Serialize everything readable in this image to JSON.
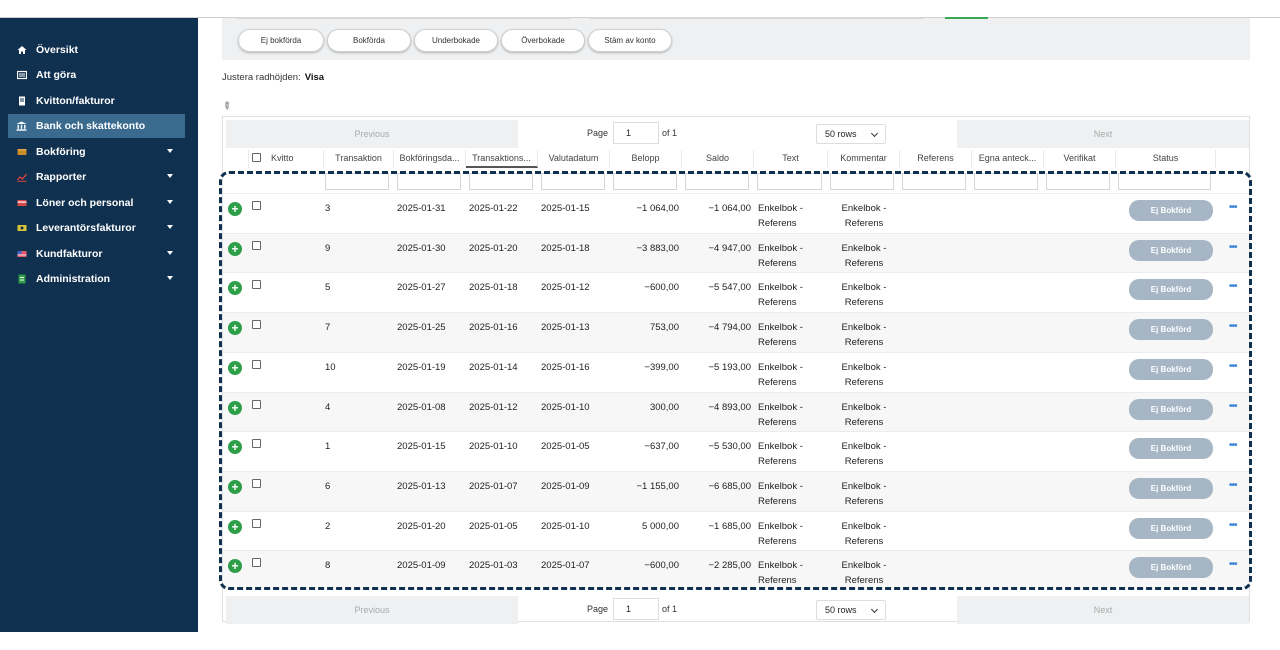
{
  "sidebar": {
    "items": [
      {
        "label": "Översikt",
        "icon": "home-icon",
        "active": false,
        "expandable": false
      },
      {
        "label": "Att göra",
        "icon": "list-icon",
        "active": false,
        "expandable": false
      },
      {
        "label": "Kvitton/fakturor",
        "icon": "receipt-icon",
        "active": false,
        "expandable": false
      },
      {
        "label": "Bank och skattekonto",
        "icon": "bank-icon",
        "active": true,
        "expandable": false
      },
      {
        "label": "Bokföring",
        "icon": "book-icon",
        "active": false,
        "expandable": true
      },
      {
        "label": "Rapporter",
        "icon": "chart-icon",
        "active": false,
        "expandable": true
      },
      {
        "label": "Löner och personal",
        "icon": "card-icon",
        "active": false,
        "expandable": true
      },
      {
        "label": "Leverantörsfakturor",
        "icon": "money-icon",
        "active": false,
        "expandable": true
      },
      {
        "label": "Kundfakturor",
        "icon": "flag-icon",
        "active": false,
        "expandable": true
      },
      {
        "label": "Administration",
        "icon": "document-icon",
        "active": false,
        "expandable": true
      }
    ]
  },
  "filters": {
    "chips": [
      "Ej bokförda",
      "Bokförda",
      "Underbokade",
      "Överbokade",
      "Stäm av konto"
    ]
  },
  "row_height": {
    "label": "Justera radhöjden:",
    "value": "Visa"
  },
  "pager": {
    "previous": "Previous",
    "page_label": "Page",
    "page_value": "1",
    "of_label": "of 1",
    "rows_option": "50 rows",
    "next": "Next"
  },
  "table": {
    "columns": [
      "",
      "Kvitto",
      "Transaktion",
      "Bokföringsda...",
      "Transaktions...",
      "Valutadatum",
      "Belopp",
      "Saldo",
      "Text",
      "Kommentar",
      "Referens",
      "Egna anteck...",
      "Verifikat",
      "Status"
    ],
    "sorted_column": "Transaktions...",
    "rows": [
      {
        "transaktion": "3",
        "bokforingsdatum": "2025-01-31",
        "transaktionsdatum": "2025-01-22",
        "valutadatum": "2025-01-15",
        "belopp": "−1 064,00",
        "saldo": "−1 064,00",
        "text_line1": "Enkelbok -",
        "text_line2": "Referens",
        "kommentar_line1": "Enkelbok -",
        "kommentar_line2": "Referens",
        "status": "Ej Bokförd"
      },
      {
        "transaktion": "9",
        "bokforingsdatum": "2025-01-30",
        "transaktionsdatum": "2025-01-20",
        "valutadatum": "2025-01-18",
        "belopp": "−3 883,00",
        "saldo": "−4 947,00",
        "text_line1": "Enkelbok -",
        "text_line2": "Referens",
        "kommentar_line1": "Enkelbok -",
        "kommentar_line2": "Referens",
        "status": "Ej Bokförd"
      },
      {
        "transaktion": "5",
        "bokforingsdatum": "2025-01-27",
        "transaktionsdatum": "2025-01-18",
        "valutadatum": "2025-01-12",
        "belopp": "−600,00",
        "saldo": "−5 547,00",
        "text_line1": "Enkelbok -",
        "text_line2": "Referens",
        "kommentar_line1": "Enkelbok -",
        "kommentar_line2": "Referens",
        "status": "Ej Bokförd"
      },
      {
        "transaktion": "7",
        "bokforingsdatum": "2025-01-25",
        "transaktionsdatum": "2025-01-16",
        "valutadatum": "2025-01-13",
        "belopp": "753,00",
        "saldo": "−4 794,00",
        "text_line1": "Enkelbok -",
        "text_line2": "Referens",
        "kommentar_line1": "Enkelbok -",
        "kommentar_line2": "Referens",
        "status": "Ej Bokförd"
      },
      {
        "transaktion": "10",
        "bokforingsdatum": "2025-01-19",
        "transaktionsdatum": "2025-01-14",
        "valutadatum": "2025-01-16",
        "belopp": "−399,00",
        "saldo": "−5 193,00",
        "text_line1": "Enkelbok -",
        "text_line2": "Referens",
        "kommentar_line1": "Enkelbok -",
        "kommentar_line2": "Referens",
        "status": "Ej Bokförd"
      },
      {
        "transaktion": "4",
        "bokforingsdatum": "2025-01-08",
        "transaktionsdatum": "2025-01-12",
        "valutadatum": "2025-01-10",
        "belopp": "300,00",
        "saldo": "−4 893,00",
        "text_line1": "Enkelbok -",
        "text_line2": "Referens",
        "kommentar_line1": "Enkelbok -",
        "kommentar_line2": "Referens",
        "status": "Ej Bokförd"
      },
      {
        "transaktion": "1",
        "bokforingsdatum": "2025-01-15",
        "transaktionsdatum": "2025-01-10",
        "valutadatum": "2025-01-05",
        "belopp": "−637,00",
        "saldo": "−5 530,00",
        "text_line1": "Enkelbok -",
        "text_line2": "Referens",
        "kommentar_line1": "Enkelbok -",
        "kommentar_line2": "Referens",
        "status": "Ej Bokförd"
      },
      {
        "transaktion": "6",
        "bokforingsdatum": "2025-01-13",
        "transaktionsdatum": "2025-01-07",
        "valutadatum": "2025-01-09",
        "belopp": "−1 155,00",
        "saldo": "−6 685,00",
        "text_line1": "Enkelbok -",
        "text_line2": "Referens",
        "kommentar_line1": "Enkelbok -",
        "kommentar_line2": "Referens",
        "status": "Ej Bokförd"
      },
      {
        "transaktion": "2",
        "bokforingsdatum": "2025-01-20",
        "transaktionsdatum": "2025-01-05",
        "valutadatum": "2025-01-10",
        "belopp": "5 000,00",
        "saldo": "−1 685,00",
        "text_line1": "Enkelbok -",
        "text_line2": "Referens",
        "kommentar_line1": "Enkelbok -",
        "kommentar_line2": "Referens",
        "status": "Ej Bokförd"
      },
      {
        "transaktion": "8",
        "bokforingsdatum": "2025-01-09",
        "transaktionsdatum": "2025-01-03",
        "valutadatum": "2025-01-07",
        "belopp": "−600,00",
        "saldo": "−2 285,00",
        "text_line1": "Enkelbok -",
        "text_line2": "Referens",
        "kommentar_line1": "Enkelbok -",
        "kommentar_line2": "Referens",
        "status": "Ej Bokförd"
      }
    ]
  },
  "colors": {
    "sidebar_bg": "#10304f",
    "sidebar_active": "#3a6b8f",
    "add_green": "#2e9e48",
    "status_pill": "#a6b6c4",
    "more_blue": "#3f86d9"
  }
}
